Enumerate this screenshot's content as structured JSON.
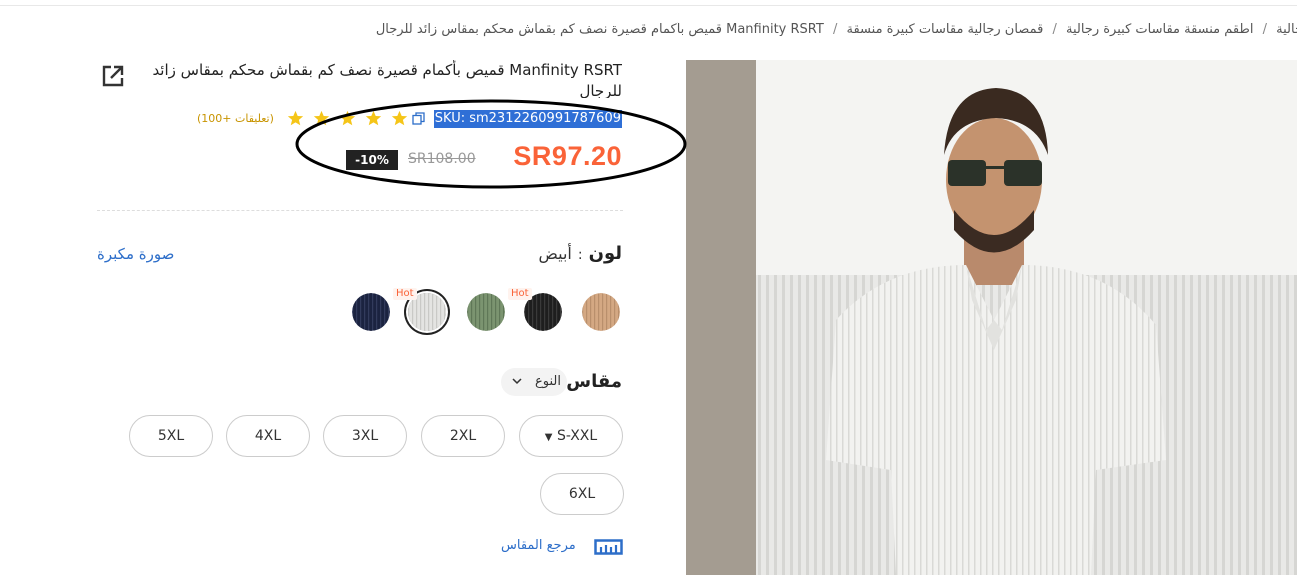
{
  "breadcrumb": {
    "items": [
      "جالية",
      "اطقم منسقة مقاسات كبيرة رجالية",
      "قمصان رجالية مقاسات كبيرة منسقة",
      "Manfinity RSRT قميص بأكمام قصيرة نصف كم بقماش محكم بمقاس زائد للرجال"
    ],
    "separator": "/"
  },
  "product": {
    "title": "Manfinity RSRT قميص بأكمام قصيرة نصف كم بقماش محكم بمقاس زائد للرجال",
    "sku": "SKU: sm2312260991787609",
    "reviews": "(100+ تعليقات)",
    "rating": 5,
    "price": "SR97.20",
    "old_price": "SR108.00",
    "discount": "-10%"
  },
  "color": {
    "label": "لون",
    "separator": ":",
    "selected": "أبيض",
    "enlarge_link": "صورة مكبرة",
    "hot_label": "Hot",
    "swatches": [
      {
        "name": "tan",
        "color": "#d4a883",
        "hot": false
      },
      {
        "name": "black",
        "color": "#1e1e1e",
        "hot": true
      },
      {
        "name": "green",
        "color": "#7b9470",
        "hot": false
      },
      {
        "name": "white",
        "color": "#e4e4e2",
        "hot": true,
        "selected": true
      },
      {
        "name": "navy",
        "color": "#1b2340",
        "hot": false
      }
    ]
  },
  "size": {
    "label": "مقاس",
    "type_label": "النوع",
    "options_row1": [
      "S-XXL",
      "2XL",
      "3XL",
      "4XL",
      "5XL"
    ],
    "option_caret": "▼",
    "options_row2": [
      "6XL"
    ],
    "guide_link": "مرجع المقاس"
  },
  "colors": {
    "price": "#fa6338",
    "link": "#2d6ec9",
    "sku_highlight": "#2f6fd6",
    "star": "#f5c518"
  }
}
